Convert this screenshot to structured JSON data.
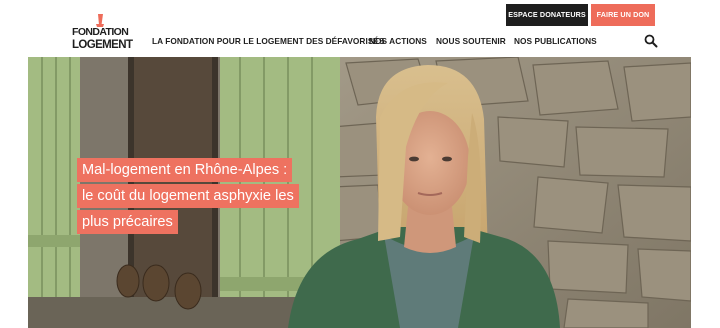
{
  "header": {
    "logo": {
      "line1": "FONDATION",
      "line2": "LOGEMENT",
      "prefix": "POUR LE"
    },
    "buttons": {
      "donors": "ESPACE DONATEURS",
      "donate": "FAIRE UN DON"
    },
    "nav": [
      {
        "label": "LA FONDATION POUR LE LOGEMENT DES DÉFAVORISÉS"
      },
      {
        "label": "NOS ACTIONS"
      },
      {
        "label": "NOUS SOUTENIR"
      },
      {
        "label": "NOS PUBLICATIONS"
      }
    ],
    "search_icon": "search-icon"
  },
  "hero": {
    "headline": [
      "Mal-logement en Rhône-Alpes :",
      "le coût du logement asphyxie les",
      "plus précaires"
    ]
  },
  "colors": {
    "accent": "#ee6c5a",
    "dark": "#1e1e1e",
    "shutter": "#a3bb82",
    "sweater": "#3f6a4c"
  }
}
